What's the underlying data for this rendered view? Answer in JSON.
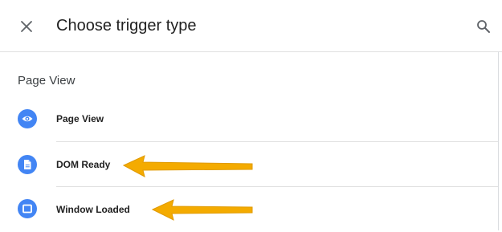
{
  "header": {
    "title": "Choose trigger type",
    "close_icon": "close-icon",
    "search_icon": "search-icon"
  },
  "section": {
    "title": "Page View",
    "items": [
      {
        "label": "Page View",
        "icon": "eye-icon"
      },
      {
        "label": "DOM Ready",
        "icon": "document-icon"
      },
      {
        "label": "Window Loaded",
        "icon": "window-icon"
      }
    ]
  },
  "colors": {
    "icon_bg": "#4285f4",
    "arrow": "#f4ab00",
    "divider": "#e0e0e0"
  }
}
